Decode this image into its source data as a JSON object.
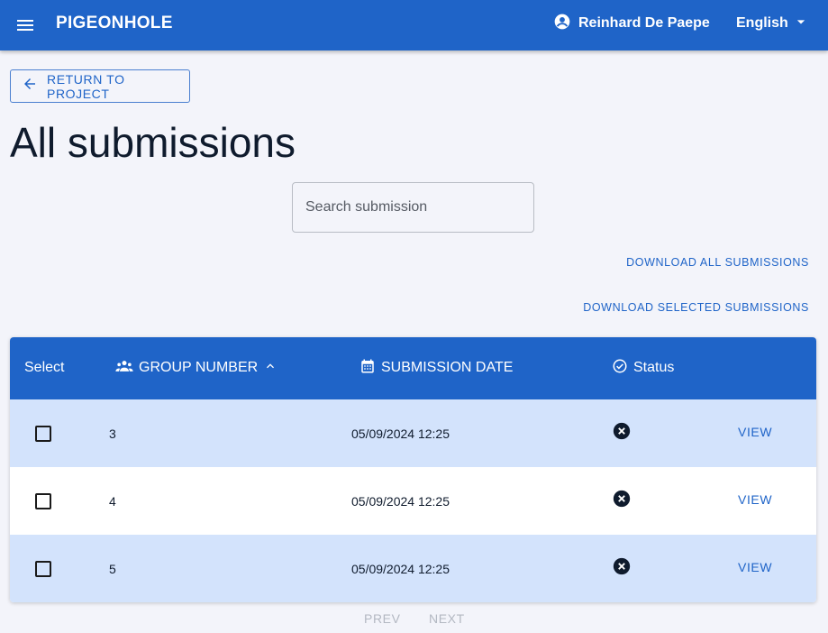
{
  "appbar": {
    "title": "PIGEONHOLE",
    "user_name": "Reinhard De Paepe",
    "language": "English"
  },
  "return_button": {
    "label": "RETURN TO PROJECT"
  },
  "page_title": "All submissions",
  "search": {
    "placeholder": "Search submission",
    "value": ""
  },
  "downloads": {
    "all_label": "DOWNLOAD ALL SUBMISSIONS",
    "selected_label": "DOWNLOAD SELECTED SUBMISSIONS"
  },
  "table": {
    "headers": {
      "select": "Select",
      "group_number": "GROUP NUMBER",
      "submission_date": "SUBMISSION DATE",
      "status": "Status"
    },
    "sort": {
      "column": "group_number",
      "direction": "ascending"
    },
    "rows": [
      {
        "group": "3",
        "date": "05/09/2024 12:25",
        "status_icon": "cancel-icon",
        "action": "VIEW",
        "checked": false
      },
      {
        "group": "4",
        "date": "05/09/2024 12:25",
        "status_icon": "cancel-icon",
        "action": "VIEW",
        "checked": false
      },
      {
        "group": "5",
        "date": "05/09/2024 12:25",
        "status_icon": "cancel-icon",
        "action": "VIEW",
        "checked": false
      }
    ]
  },
  "pagination": {
    "prev_label": "PREV",
    "next_label": "NEXT",
    "prev_disabled": true,
    "next_disabled": true
  },
  "colors": {
    "primary": "#1f64c8",
    "row_alt": "#d3e3fc",
    "background": "#f3f4fa",
    "status_fail": "#0f1b2d",
    "disabled": "#b3b8c2"
  }
}
